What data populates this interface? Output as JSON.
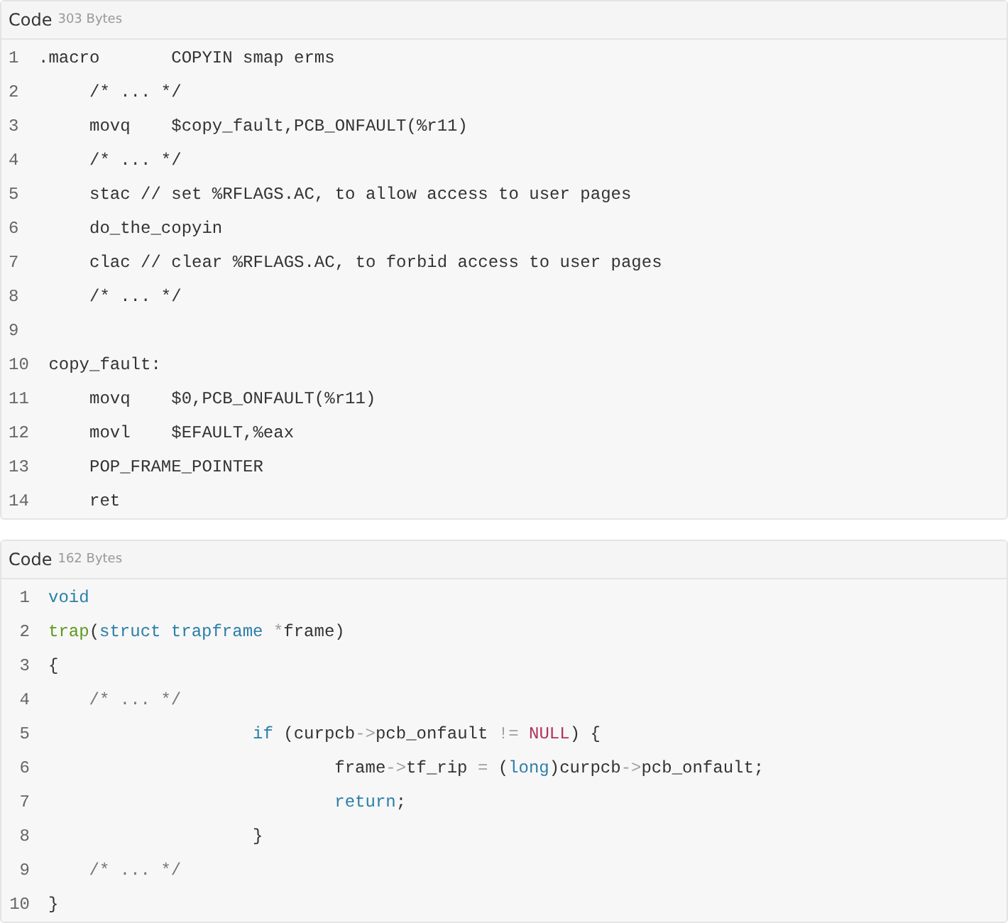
{
  "code_blocks": [
    {
      "label": "Code",
      "size": "303 Bytes",
      "lines": [
        {
          "number": "1",
          "tokens": [
            {
              "text": ".macro       COPYIN smap erms",
              "kind": "plain"
            }
          ]
        },
        {
          "number": "2",
          "tokens": [
            {
              "text": "     /* ... */",
              "kind": "plain"
            }
          ]
        },
        {
          "number": "3",
          "tokens": [
            {
              "text": "     movq    $copy_fault,PCB_ONFAULT(%r11)",
              "kind": "plain"
            }
          ]
        },
        {
          "number": "4",
          "tokens": [
            {
              "text": "     /* ... */",
              "kind": "plain"
            }
          ]
        },
        {
          "number": "5",
          "tokens": [
            {
              "text": "     stac // set %RFLAGS.AC, to allow access to user pages",
              "kind": "plain"
            }
          ]
        },
        {
          "number": "6",
          "tokens": [
            {
              "text": "     do_the_copyin",
              "kind": "plain"
            }
          ]
        },
        {
          "number": "7",
          "tokens": [
            {
              "text": "     clac // clear %RFLAGS.AC, to forbid access to user pages",
              "kind": "plain"
            }
          ]
        },
        {
          "number": "8",
          "tokens": [
            {
              "text": "     /* ... */",
              "kind": "plain"
            }
          ]
        },
        {
          "number": "9"
        },
        {
          "number": "10",
          "tokens": [
            {
              "text": " copy_fault:",
              "kind": "plain"
            }
          ]
        },
        {
          "number": "11",
          "tokens": [
            {
              "text": "     movq    $0,PCB_ONFAULT(%r11)",
              "kind": "plain"
            }
          ]
        },
        {
          "number": "12",
          "tokens": [
            {
              "text": "     movl    $EFAULT,%eax",
              "kind": "plain"
            }
          ]
        },
        {
          "number": "13",
          "tokens": [
            {
              "text": "     POP_FRAME_POINTER",
              "kind": "plain"
            }
          ]
        },
        {
          "number": "14",
          "tokens": [
            {
              "text": "     ret",
              "kind": "plain"
            }
          ]
        }
      ]
    },
    {
      "label": "Code",
      "size": "162 Bytes",
      "lines": [
        {
          "number": "1",
          "tokens": [
            {
              "text": "void",
              "kind": "keyword"
            }
          ]
        },
        {
          "number": "2",
          "tokens": [
            {
              "text": "trap",
              "kind": "function"
            },
            {
              "text": "(",
              "kind": "plain"
            },
            {
              "text": "struct trapframe ",
              "kind": "keyword"
            },
            {
              "text": "*",
              "kind": "punct"
            },
            {
              "text": "frame)",
              "kind": "plain"
            }
          ]
        },
        {
          "number": "3",
          "tokens": [
            {
              "text": "{",
              "kind": "plain"
            }
          ]
        },
        {
          "number": "4",
          "tokens": [
            {
              "text": "    /* ... */",
              "kind": "comment"
            }
          ]
        },
        {
          "number": "5",
          "tokens": [
            {
              "text": "                    if ",
              "kind": "keyword"
            },
            {
              "text": "(curpcb",
              "kind": "plain"
            },
            {
              "text": "->",
              "kind": "punct"
            },
            {
              "text": "pcb_onfault ",
              "kind": "plain"
            },
            {
              "text": "!=",
              "kind": "punct"
            },
            {
              "text": " NULL",
              "kind": "constant"
            },
            {
              "text": ") {",
              "kind": "plain"
            }
          ]
        },
        {
          "number": "6",
          "tokens": [
            {
              "text": "                            frame",
              "kind": "plain"
            },
            {
              "text": "->",
              "kind": "punct"
            },
            {
              "text": "tf_rip ",
              "kind": "plain"
            },
            {
              "text": "=",
              "kind": "punct"
            },
            {
              "text": " (",
              "kind": "plain"
            },
            {
              "text": "long",
              "kind": "keyword"
            },
            {
              "text": ")curpcb",
              "kind": "plain"
            },
            {
              "text": "->",
              "kind": "punct"
            },
            {
              "text": "pcb_onfault;",
              "kind": "plain"
            }
          ]
        },
        {
          "number": "7",
          "tokens": [
            {
              "text": "                            return",
              "kind": "keyword"
            },
            {
              "text": ";",
              "kind": "plain"
            }
          ]
        },
        {
          "number": "8",
          "tokens": [
            {
              "text": "                    }",
              "kind": "plain"
            }
          ]
        },
        {
          "number": "9",
          "tokens": [
            {
              "text": "    /* ... */",
              "kind": "comment"
            }
          ]
        },
        {
          "number": "10",
          "tokens": [
            {
              "text": "}",
              "kind": "plain"
            }
          ]
        }
      ]
    }
  ]
}
